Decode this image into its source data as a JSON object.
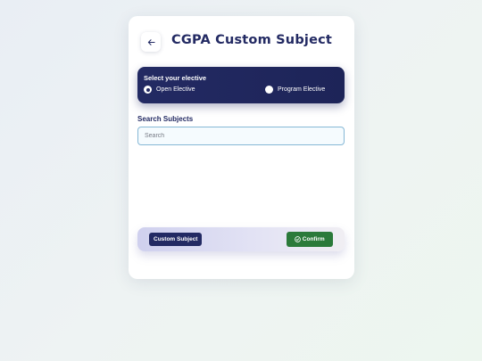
{
  "header": {
    "back_icon": "arrow-left-icon",
    "title": "CGPA Custom Subject"
  },
  "elective": {
    "heading": "Select your elective",
    "options": [
      {
        "label": "Open Elective",
        "selected": true
      },
      {
        "label": "Program Elective",
        "selected": false
      }
    ]
  },
  "search": {
    "label": "Search Subjects",
    "placeholder": "Search",
    "value": ""
  },
  "actions": {
    "custom_subject_label": "Custom Subject",
    "confirm_label": "Confirm",
    "confirm_icon": "check-circle-icon"
  },
  "colors": {
    "primary": "#232a63",
    "confirm": "#2b7a3a",
    "input_border": "#86b8d6"
  }
}
